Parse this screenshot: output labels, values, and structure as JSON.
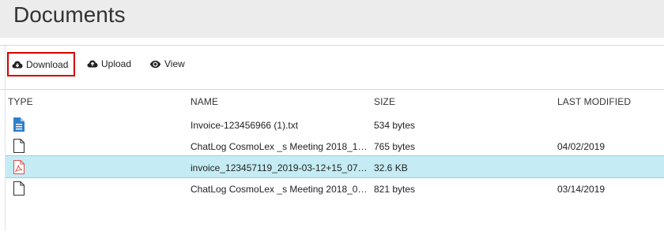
{
  "page": {
    "title": "Documents"
  },
  "toolbar": {
    "download_label": "Download",
    "upload_label": "Upload",
    "view_label": "View"
  },
  "table": {
    "columns": [
      "TYPE",
      "NAME",
      "SIZE",
      "LAST MODIFIED"
    ],
    "rows": [
      {
        "icon": "text-document-icon",
        "name": "Invoice-123456966 (1).txt",
        "size": "534 bytes",
        "modified": "",
        "selected": false
      },
      {
        "icon": "blank-file-icon",
        "name": "ChatLog CosmoLex _s Meeting 2018_1…",
        "size": "765 bytes",
        "modified": "04/02/2019",
        "selected": false
      },
      {
        "icon": "pdf-file-icon",
        "name": "invoice_123457119_2019-03-12+15_07…",
        "size": "32.6 KB",
        "modified": "",
        "selected": true
      },
      {
        "icon": "blank-file-icon",
        "name": "ChatLog CosmoLex _s Meeting 2018_0…",
        "size": "821 bytes",
        "modified": "03/14/2019",
        "selected": false
      }
    ]
  },
  "colors": {
    "selected_row": "#c5ecf4",
    "highlight_border": "#d40000",
    "txt_icon": "#2f7fc8",
    "pdf_icon": "#e05050"
  }
}
